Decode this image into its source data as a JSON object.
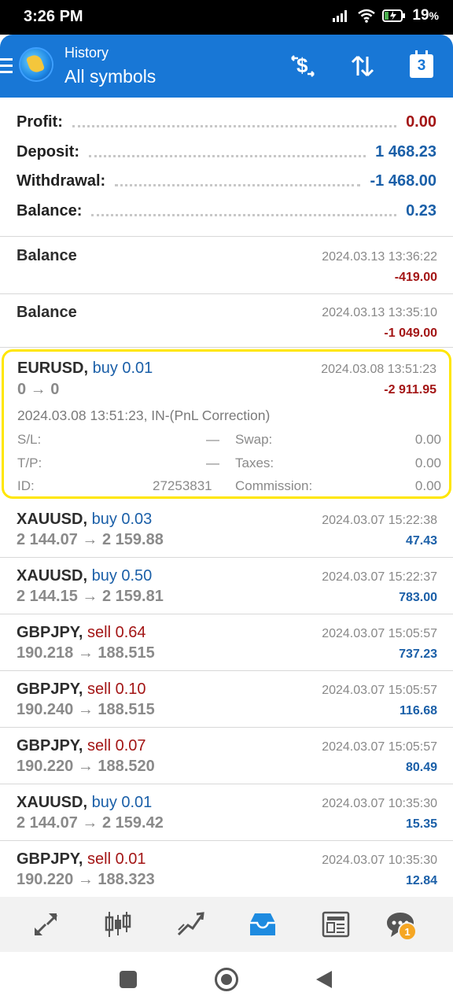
{
  "status_bar": {
    "time": "3:26 PM",
    "battery": "19",
    "battery_unit": "%"
  },
  "app_bar": {
    "subtitle": "History",
    "title": "All symbols",
    "calendar_day": "3"
  },
  "summary": [
    {
      "label": "Profit:",
      "value": "0.00",
      "color": "red"
    },
    {
      "label": "Deposit:",
      "value": "1 468.23",
      "color": "blue"
    },
    {
      "label": "Withdrawal:",
      "value": "-1 468.00",
      "color": "blue"
    },
    {
      "label": "Balance:",
      "value": "0.23",
      "color": "blue"
    }
  ],
  "balance_ops": [
    {
      "label": "Balance",
      "datetime": "2024.03.13 13:36:22",
      "amount": "-419.00"
    },
    {
      "label": "Balance",
      "datetime": "2024.03.13 13:35:10",
      "amount": "-1 049.00"
    }
  ],
  "expanded_deal": {
    "symbol": "EURUSD,",
    "side": "buy 0.01",
    "prices": "0 → 0",
    "datetime": "2024.03.08 13:51:23",
    "profit": "-2 911.95",
    "comment": "2024.03.08 13:51:23, IN-(PnL Correction)",
    "sl_label": "S/L:",
    "sl_value": "—",
    "tp_label": "T/P:",
    "tp_value": "—",
    "id_label": "ID:",
    "id_value": "27253831",
    "swap_label": "Swap:",
    "swap_value": "0.00",
    "taxes_label": "Taxes:",
    "taxes_value": "0.00",
    "commission_label": "Commission:",
    "commission_value": "0.00"
  },
  "deals": [
    {
      "symbol": "XAUUSD,",
      "side": "buy 0.03",
      "type": "buy",
      "prices": "2 144.07 → 2 159.88",
      "datetime": "2024.03.07 15:22:38",
      "profit": "47.43"
    },
    {
      "symbol": "XAUUSD,",
      "side": "buy 0.50",
      "type": "buy",
      "prices": "2 144.15 → 2 159.81",
      "datetime": "2024.03.07 15:22:37",
      "profit": "783.00"
    },
    {
      "symbol": "GBPJPY,",
      "side": "sell 0.64",
      "type": "sell",
      "prices": "190.218 → 188.515",
      "datetime": "2024.03.07 15:05:57",
      "profit": "737.23"
    },
    {
      "symbol": "GBPJPY,",
      "side": "sell 0.10",
      "type": "sell",
      "prices": "190.240 → 188.515",
      "datetime": "2024.03.07 15:05:57",
      "profit": "116.68"
    },
    {
      "symbol": "GBPJPY,",
      "side": "sell 0.07",
      "type": "sell",
      "prices": "190.220 → 188.520",
      "datetime": "2024.03.07 15:05:57",
      "profit": "80.49"
    },
    {
      "symbol": "XAUUSD,",
      "side": "buy 0.01",
      "type": "buy",
      "prices": "2 144.07 → 2 159.42",
      "datetime": "2024.03.07 10:35:30",
      "profit": "15.35"
    },
    {
      "symbol": "GBPJPY,",
      "side": "sell 0.01",
      "type": "sell",
      "prices": "190.220 → 188.323",
      "datetime": "2024.03.07 10:35:30",
      "profit": "12.84"
    }
  ],
  "bottom_nav": {
    "items": [
      "quotes-icon",
      "chart-icon",
      "trade-icon",
      "history-icon",
      "news-icon",
      "chat-icon"
    ],
    "active": "history-icon",
    "chat_badge": "1"
  },
  "colors": {
    "accent": "#1877d6",
    "loss": "#a31515",
    "gain": "#1a5fa8",
    "highlight": "#ffe600",
    "badge": "#f5a623"
  }
}
